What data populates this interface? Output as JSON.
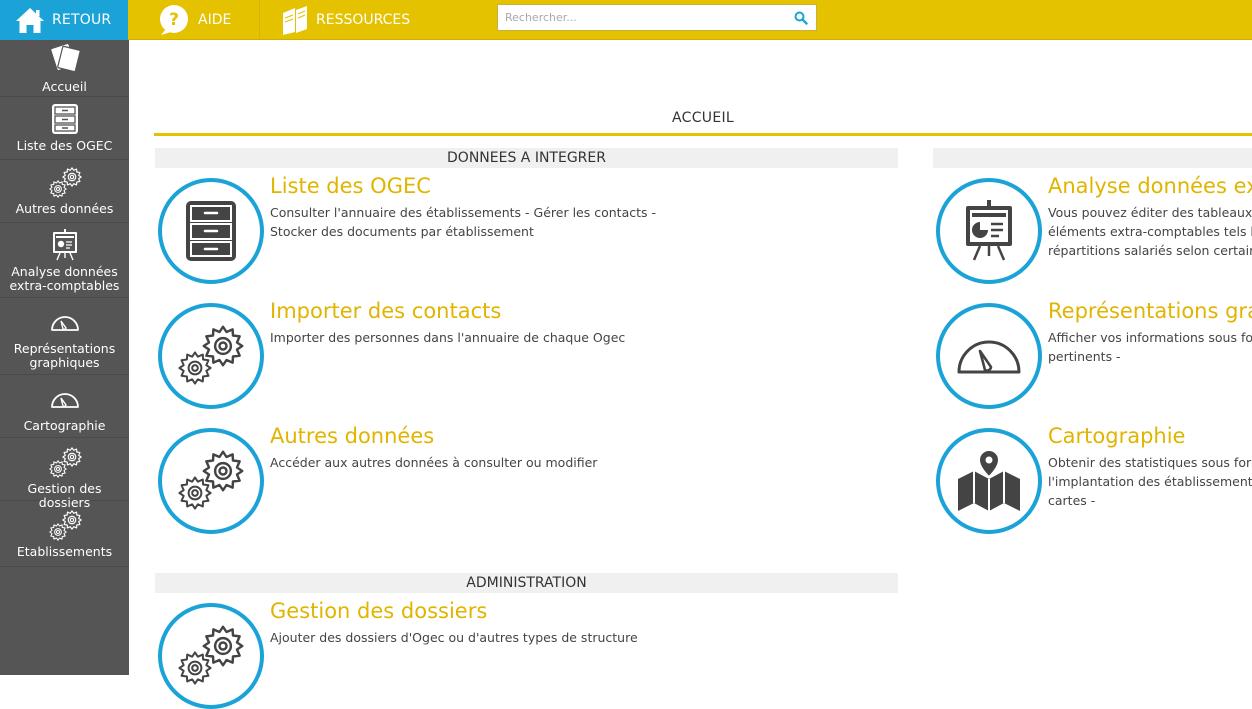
{
  "topbar": {
    "retour_label": "RETOUR",
    "aide_label": "AIDE",
    "ressources_label": "RESSOURCES",
    "search_placeholder": "Rechercher..."
  },
  "sidebar": {
    "items": [
      {
        "label": "Accueil",
        "icon": "cards-icon"
      },
      {
        "label": "Liste des OGEC",
        "icon": "cabinet-icon"
      },
      {
        "label": "Autres données",
        "icon": "gears-icon"
      },
      {
        "label": "Analyse données extra-comptables",
        "icon": "presentation-icon"
      },
      {
        "label": "Représentations graphiques",
        "icon": "gauge-icon"
      },
      {
        "label": "Cartographie",
        "icon": "gauge-icon"
      },
      {
        "label": "Gestion des dossiers",
        "icon": "gears-icon"
      },
      {
        "label": "Etablissements",
        "icon": "gears-icon"
      }
    ]
  },
  "main": {
    "title": "ACCUEIL",
    "sections": {
      "integrer": "DONNEES A INTEGRER",
      "administration": "ADMINISTRATION"
    },
    "cards": {
      "liste_ogec": {
        "title": "Liste des OGEC",
        "desc_1": "Consulter l'annuaire des établissements - Gérer les contacts -",
        "desc_2": "Stocker des documents par établissement"
      },
      "importer": {
        "title": "Importer des contacts",
        "desc_1": "Importer des personnes dans l'annuaire de chaque Ogec"
      },
      "autres": {
        "title": "Autres données",
        "desc_1": "Accéder aux autres données à consulter ou modifier"
      },
      "gestion": {
        "title": "Gestion des dossiers",
        "desc_1": "Ajouter des dossiers d'Ogec ou d'autres types de structure"
      },
      "analyse": {
        "title": "Analyse données extr",
        "desc_1": "Vous pouvez éditer des tableaux c",
        "desc_2": "éléments extra-comptables tels le",
        "desc_3": "répartitions salariés selon certains"
      },
      "representations": {
        "title": "Représentations grap",
        "desc_1": "Afficher vos informations sous for",
        "desc_2": "pertinents -"
      },
      "cartographie": {
        "title": "Cartographie",
        "desc_1": "Obtenir des statistiques sous form",
        "desc_2": "l'implantation des établissements",
        "desc_3": "cartes -"
      }
    }
  },
  "colors": {
    "topbar": "#e4c200",
    "accent_blue": "#1ba3d8",
    "sidebar": "#555555",
    "card_title": "#e1b400"
  }
}
